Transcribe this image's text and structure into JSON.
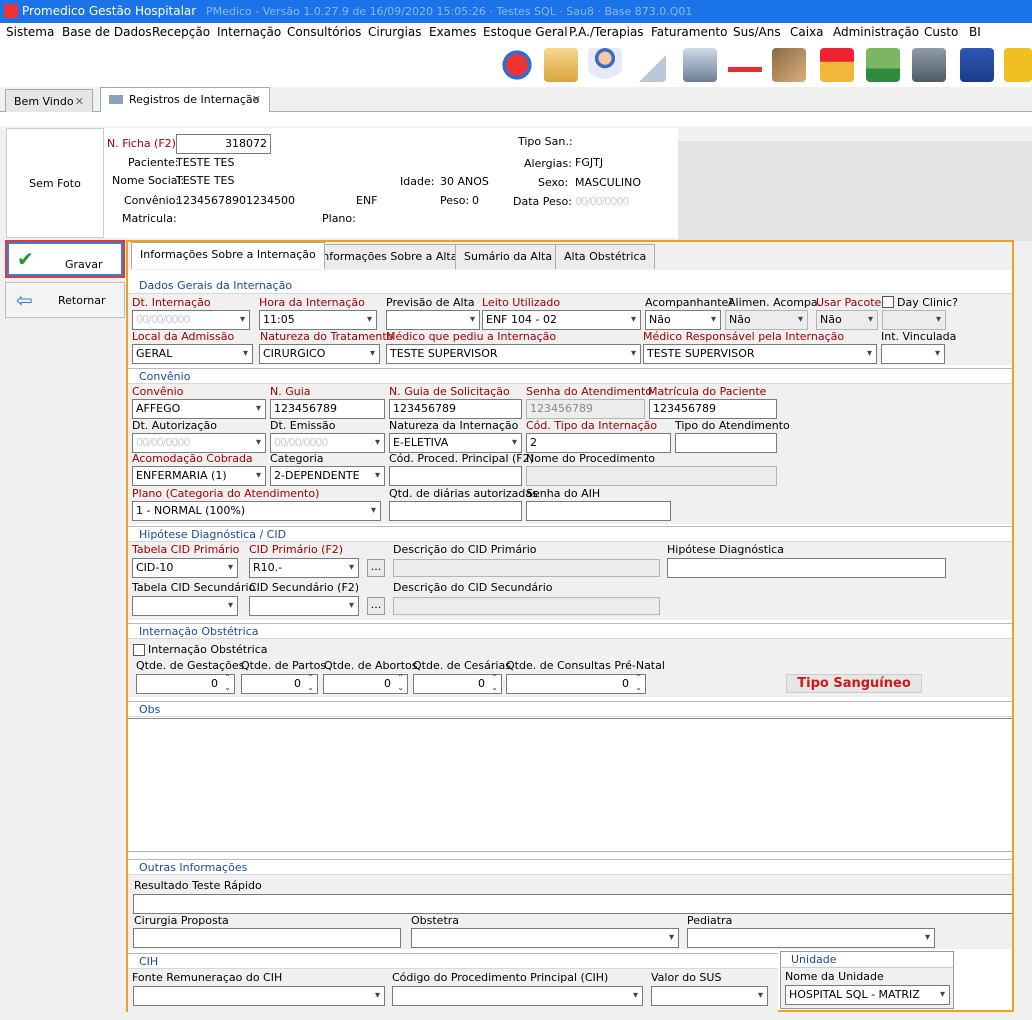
{
  "window": {
    "title": "Promedico Gestão Hospitalar",
    "title_blur": "PMedico - Versão 1.0.27.9 de 16/09/2020 15:05:26 · Testes SQL · Sau8 · Base 873.0.Q01"
  },
  "menu": [
    "Sistema",
    "Base de Dados",
    "Recepção",
    "Internação",
    "Consultórios",
    "Cirurgias",
    "Exames",
    "Estoque Geral",
    "P.A./Terapias",
    "Faturamento",
    "Sus/Ans",
    "Caixa",
    "Administração",
    "Custo",
    "BI"
  ],
  "toolbar_icons": [
    "refresh-icon",
    "users-icon",
    "doctor-icon",
    "clipboard-icon",
    "printer-icon",
    "ambulance-icon",
    "boxes-icon",
    "chart-up-icon",
    "money-down-icon",
    "safe-icon",
    "cash-register-icon",
    "phone-icon"
  ],
  "tabs": [
    {
      "label": "Bem Vindo"
    },
    {
      "label": "Registros de Internação"
    }
  ],
  "photo": {
    "label": "Sem Foto"
  },
  "patient": {
    "ficha_label": "N. Ficha (F2):",
    "ficha_value": "318072",
    "paciente_label": "Paciente:",
    "paciente_value": "TESTE TES",
    "nome_social_label": "Nome Social:",
    "nome_social_value": "TESTE TES",
    "convenio_label": "Convênio:",
    "convenio_value": "12345678901234500",
    "convenio_extra": "ENF",
    "matricula_label": "Matricula:",
    "plano_label": "Plano:",
    "idade_label": "Idade:",
    "idade_value": "30 ANOS",
    "peso_label": "Peso:",
    "peso_value": "0",
    "tipo_san_label": "Tipo San.:",
    "alergias_label": "Alergias:",
    "alergias_value": "FGJTJ",
    "sexo_label": "Sexo:",
    "sexo_value": "MASCULINO",
    "data_peso_label": "Data Peso:",
    "blur": "00/00/0000"
  },
  "sidebar": {
    "gravar": "Gravar",
    "retornar": "Retornar"
  },
  "form_tabs": [
    "Informações Sobre a Internação",
    "Informações Sobre a Alta",
    "Sumário da Alta",
    "Alta Obstétrica"
  ],
  "s1": {
    "title": "Dados Gerais da Internação",
    "dt_internacao": "Dt. Internação",
    "hora": "Hora da Internação",
    "hora_value": "11:05",
    "previsao": "Previsão de Alta",
    "leito": "Leito Utilizado",
    "leito_value": "ENF 104 - 02",
    "acompanhante": "Acompanhante?",
    "acompanhante_value": "Não",
    "alimen": "Alimen. Acompa.",
    "alimen_value": "Não",
    "usar_pacote": "Usar Pacote?",
    "usar_pacote_value": "Não",
    "day_clinic": "Day Clinic?",
    "local": "Local da Admissão",
    "local_value": "GERAL",
    "natureza": "Natureza do Tratamento",
    "natureza_value": "CIRURGICO",
    "medico_pediu": "Médico que pediu a Internação",
    "medico_pediu_value": "TESTE SUPERVISOR",
    "medico_resp": "Médico Responsável pela Internação",
    "medico_resp_value": "TESTE SUPERVISOR",
    "int_vinculada": "Int. Vinculada"
  },
  "s2": {
    "title": "Convênio",
    "convenio": "Convênio",
    "convenio_value": "AFFEGO",
    "n_guia": "N. Guia",
    "n_guia_value": "123456789",
    "n_guia_sol": "N. Guia de Solicitação",
    "n_guia_sol_value": "123456789",
    "senha_at": "Senha do Atendimento",
    "senha_at_value": "123456789",
    "matricula_pac": "Matrícula do Paciente",
    "matricula_pac_value": "123456789",
    "dt_aut": "Dt. Autorização",
    "dt_emissao": "Dt. Emissão",
    "natureza_int": "Natureza da Internação",
    "natureza_int_value": "E-ELETIVA",
    "cod_tipo": "Cód. Tipo da Internação",
    "cod_tipo_value": "2",
    "tipo_atend": "Tipo do Atendimento",
    "acomodacao": "Acomodação Cobrada",
    "acomodacao_value": "ENFERMARIA (1)",
    "categoria": "Categoria",
    "categoria_value": "2-DEPENDENTE",
    "cod_proc": "Cód. Proced. Principal (F2)",
    "nome_proc": "Nome do Procedimento",
    "plano": "Plano (Categoria do Atendimento)",
    "plano_value": "1 - NORMAL (100%)",
    "qtd_diarias": "Qtd. de diárias autorizadas",
    "senha_aih": "Senha do AIH"
  },
  "s3": {
    "title": "Hipótese Diagnóstica / CID",
    "tabela_cid1": "Tabela CID Primário",
    "tabela_cid1_value": "CID-10",
    "cid1": "CID Primário (F2)",
    "cid1_value": "R10.-",
    "desc_cid1": "Descrição do CID Primário",
    "hipotese": "Hipótese Diagnóstica",
    "tabela_cid2": "Tabela CID Secundário",
    "cid2": "CID Secundário (F2)",
    "desc_cid2": "Descrição do CID Secundário",
    "dots": "..."
  },
  "s4": {
    "title": "Internação Obstétrica",
    "check": "Internação Obstétrica",
    "gestacoes": "Qtde. de Gestações",
    "partos": "Qtde. de Partos",
    "abortos": "Qtde. de Abortos",
    "cesarias": "Qtde. de Cesárias",
    "consultas": "Qtde. de Consultas Pré-Natal",
    "zero": "0",
    "tipo_sanguineo": "Tipo Sanguíneo"
  },
  "s5": {
    "title": "Obs"
  },
  "s6": {
    "title": "Outras Informações",
    "resultado": "Resultado Teste Rápido",
    "cirurgia": "Cirurgia Proposta",
    "obstetra": "Obstetra",
    "pediatra": "Pediatra"
  },
  "s7": {
    "title": "CIH",
    "fonte": "Fonte Remuneraçao do CIH",
    "codigo": "Código do Procedimento Principal (CIH)",
    "valor": "Valor do SUS"
  },
  "s8": {
    "title": "Unidade",
    "nome": "Nome da Unidade",
    "nome_value": "HOSPITAL SQL - MATRIZ"
  }
}
